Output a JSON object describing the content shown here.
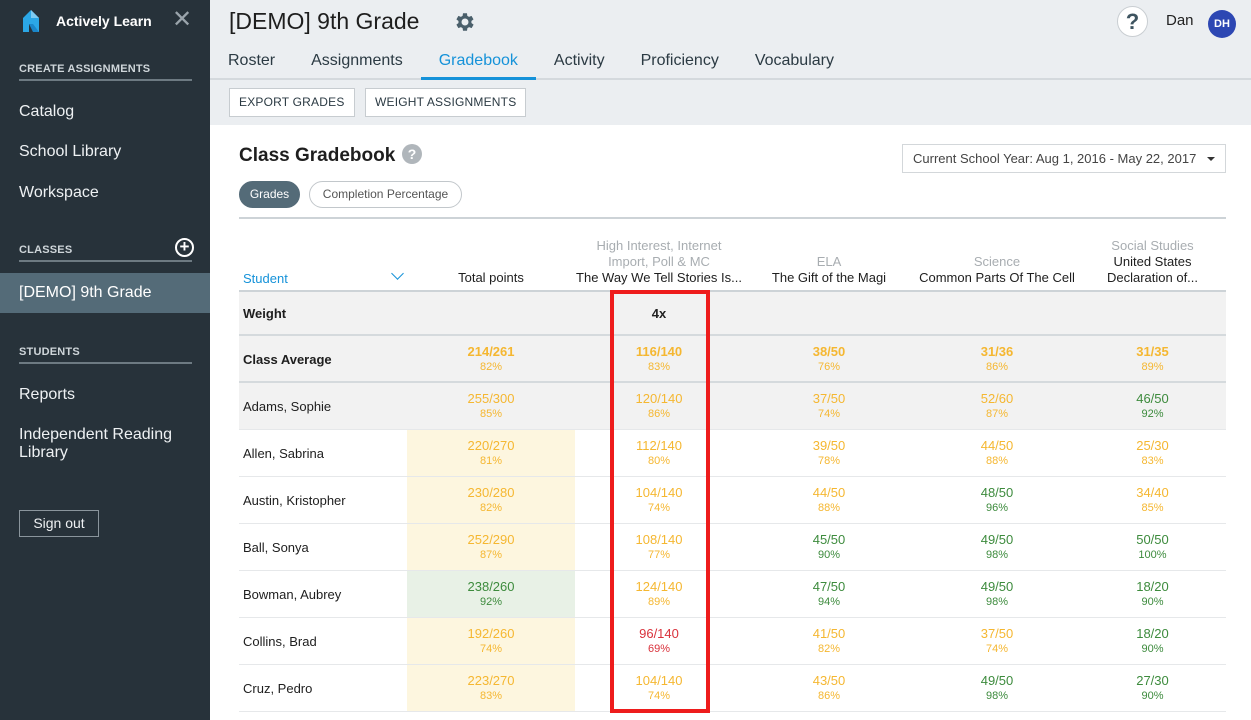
{
  "sidebar": {
    "brand": "Actively Learn",
    "sections": {
      "create": "CREATE ASSIGNMENTS",
      "classes": "CLASSES",
      "students": "STUDENTS"
    },
    "create_items": [
      "Catalog",
      "School Library",
      "Workspace"
    ],
    "active_class": "[DEMO] 9th Grade",
    "student_items": [
      "Reports",
      "Independent Reading Library"
    ],
    "sign_out": "Sign out"
  },
  "header": {
    "class_title": "[DEMO] 9th Grade",
    "help": "?",
    "user_name": "Dan",
    "avatar_initials": "DH",
    "tabs": [
      "Roster",
      "Assignments",
      "Gradebook",
      "Activity",
      "Proficiency",
      "Vocabulary"
    ],
    "active_tab": "Gradebook"
  },
  "toolbar": {
    "export": "EXPORT GRADES",
    "weight": "WEIGHT ASSIGNMENTS"
  },
  "gradebook": {
    "title": "Class Gradebook",
    "help": "?",
    "date_range": "Current School Year: Aug 1, 2016 - May 22, 2017",
    "view_toggle": [
      "Grades",
      "Completion Percentage"
    ],
    "active_view": "Grades",
    "columns": {
      "student": "Student",
      "total": "Total points",
      "assignments": [
        {
          "category": "High Interest, Internet Import, Poll & MC",
          "title": "The Way We Tell Stories Is..."
        },
        {
          "category": "ELA",
          "title": "The Gift of the Magi"
        },
        {
          "category": "Science",
          "title": "Common Parts Of The Cell"
        },
        {
          "category": "Social Studies",
          "title": "United States Declaration of..."
        }
      ]
    },
    "weight_row": {
      "label": "Weight",
      "values": [
        "",
        "4x",
        "",
        "",
        ""
      ]
    },
    "class_average": {
      "label": "Class Average",
      "cells": [
        {
          "score": "214/261",
          "pct": "82%",
          "color": "yellow"
        },
        {
          "score": "116/140",
          "pct": "83%",
          "color": "yellow"
        },
        {
          "score": "38/50",
          "pct": "76%",
          "color": "yellow"
        },
        {
          "score": "31/36",
          "pct": "86%",
          "color": "yellow"
        },
        {
          "score": "31/35",
          "pct": "89%",
          "color": "yellow"
        }
      ]
    },
    "students": [
      {
        "name": "Adams, Sophie",
        "cells": [
          {
            "score": "255/300",
            "pct": "85%",
            "color": "yellow"
          },
          {
            "score": "120/140",
            "pct": "86%",
            "color": "yellow"
          },
          {
            "score": "37/50",
            "pct": "74%",
            "color": "yellow"
          },
          {
            "score": "52/60",
            "pct": "87%",
            "color": "yellow"
          },
          {
            "score": "46/50",
            "pct": "92%",
            "color": "green"
          }
        ]
      },
      {
        "name": "Allen, Sabrina",
        "cells": [
          {
            "score": "220/270",
            "pct": "81%",
            "color": "yellow"
          },
          {
            "score": "112/140",
            "pct": "80%",
            "color": "yellow"
          },
          {
            "score": "39/50",
            "pct": "78%",
            "color": "yellow"
          },
          {
            "score": "44/50",
            "pct": "88%",
            "color": "yellow"
          },
          {
            "score": "25/30",
            "pct": "83%",
            "color": "yellow"
          }
        ]
      },
      {
        "name": "Austin, Kristopher",
        "cells": [
          {
            "score": "230/280",
            "pct": "82%",
            "color": "yellow"
          },
          {
            "score": "104/140",
            "pct": "74%",
            "color": "yellow"
          },
          {
            "score": "44/50",
            "pct": "88%",
            "color": "yellow"
          },
          {
            "score": "48/50",
            "pct": "96%",
            "color": "green"
          },
          {
            "score": "34/40",
            "pct": "85%",
            "color": "yellow"
          }
        ]
      },
      {
        "name": "Ball, Sonya",
        "cells": [
          {
            "score": "252/290",
            "pct": "87%",
            "color": "yellow"
          },
          {
            "score": "108/140",
            "pct": "77%",
            "color": "yellow"
          },
          {
            "score": "45/50",
            "pct": "90%",
            "color": "green"
          },
          {
            "score": "49/50",
            "pct": "98%",
            "color": "green"
          },
          {
            "score": "50/50",
            "pct": "100%",
            "color": "green"
          }
        ]
      },
      {
        "name": "Bowman, Aubrey",
        "cells": [
          {
            "score": "238/260",
            "pct": "92%",
            "color": "green"
          },
          {
            "score": "124/140",
            "pct": "89%",
            "color": "yellow"
          },
          {
            "score": "47/50",
            "pct": "94%",
            "color": "green"
          },
          {
            "score": "49/50",
            "pct": "98%",
            "color": "green"
          },
          {
            "score": "18/20",
            "pct": "90%",
            "color": "green"
          }
        ]
      },
      {
        "name": "Collins, Brad",
        "cells": [
          {
            "score": "192/260",
            "pct": "74%",
            "color": "yellow"
          },
          {
            "score": "96/140",
            "pct": "69%",
            "color": "red"
          },
          {
            "score": "41/50",
            "pct": "82%",
            "color": "yellow"
          },
          {
            "score": "37/50",
            "pct": "74%",
            "color": "yellow"
          },
          {
            "score": "18/20",
            "pct": "90%",
            "color": "green"
          }
        ]
      },
      {
        "name": "Cruz, Pedro",
        "cells": [
          {
            "score": "223/270",
            "pct": "83%",
            "color": "yellow"
          },
          {
            "score": "104/140",
            "pct": "74%",
            "color": "yellow"
          },
          {
            "score": "43/50",
            "pct": "86%",
            "color": "yellow"
          },
          {
            "score": "49/50",
            "pct": "98%",
            "color": "green"
          },
          {
            "score": "27/30",
            "pct": "90%",
            "color": "green"
          }
        ]
      }
    ]
  },
  "colors": {
    "accent": "#1592d9",
    "sidebar": "#27323a",
    "yellow": "#f5b731",
    "green": "#3d8b3d",
    "red": "#d9323c",
    "highlight": "#ee1c1c"
  }
}
